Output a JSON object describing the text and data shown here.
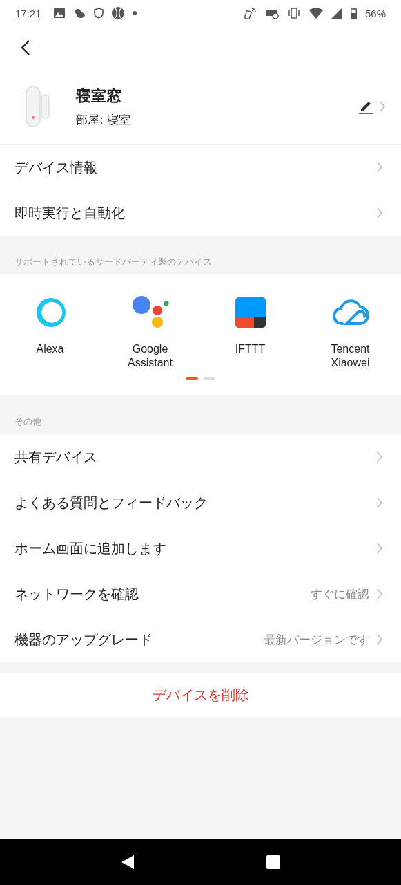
{
  "status_bar": {
    "time": "17:21",
    "battery": "56%"
  },
  "device": {
    "name": "寝室窓",
    "room": "部屋: 寝室"
  },
  "top_rows": [
    {
      "label": "デバイス情報"
    },
    {
      "label": "即時実行と自動化"
    }
  ],
  "third_party": {
    "heading": "サポートされているサードパーティ製のデバイス",
    "services": [
      {
        "kind": "alexa",
        "label": "Alexa"
      },
      {
        "kind": "google",
        "label": "Google Assistant"
      },
      {
        "kind": "ifttt",
        "label": "IFTTT"
      },
      {
        "kind": "tencent",
        "label": "Tencent Xiaowei"
      }
    ],
    "pages": [
      {
        "selected": true
      },
      {
        "selected": false
      }
    ]
  },
  "other": {
    "heading": "その他",
    "rows": [
      {
        "label": "共有デバイス"
      },
      {
        "label": "よくある質問とフィードバック"
      },
      {
        "label": "ホーム画面に追加します"
      },
      {
        "label": "ネットワークを確認",
        "value": "すぐに確認"
      },
      {
        "label": "機器のアップグレード",
        "value": "最新バージョンです"
      }
    ]
  },
  "delete_button": "デバイスを削除"
}
